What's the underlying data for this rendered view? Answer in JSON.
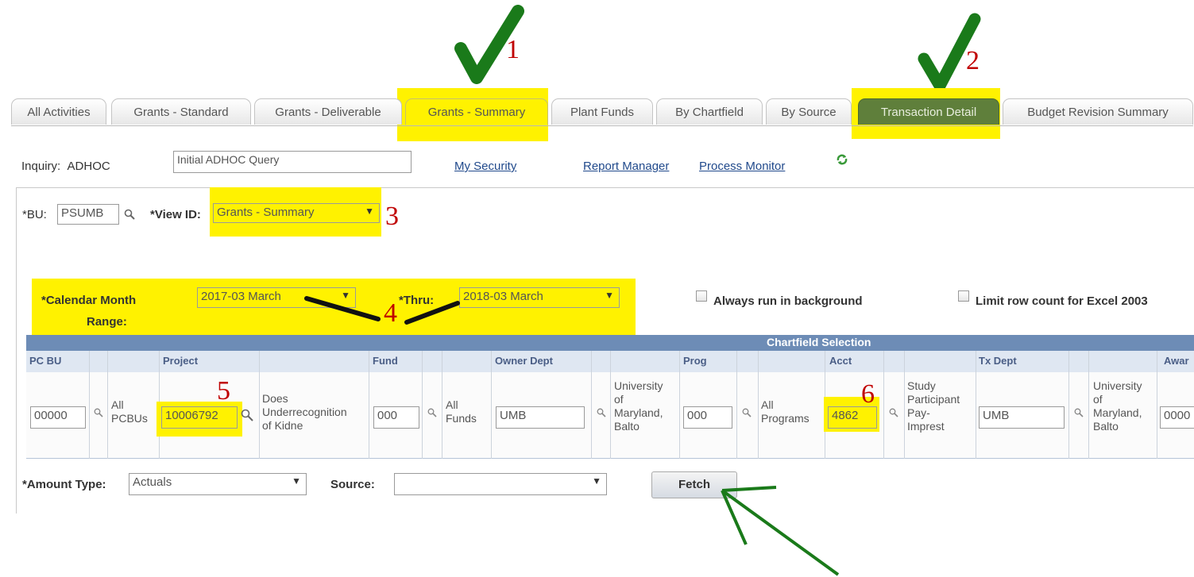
{
  "annotations": {
    "n1": "1",
    "n2": "2",
    "n3": "3",
    "n4": "4",
    "n5": "5",
    "n6": "6"
  },
  "tabs": [
    {
      "label": "All Activities"
    },
    {
      "label": "Grants - Standard"
    },
    {
      "label": "Grants - Deliverable"
    },
    {
      "label": "Grants - Summary"
    },
    {
      "label": "Plant Funds"
    },
    {
      "label": "By Chartfield"
    },
    {
      "label": "By Source"
    },
    {
      "label": "Transaction Detail"
    },
    {
      "label": "Budget Revision Summary"
    }
  ],
  "inquiry": {
    "label": "Inquiry:",
    "value": "ADHOC",
    "description": "Initial ADHOC Query"
  },
  "links": {
    "my_security": "My Security",
    "report_manager": "Report Manager",
    "process_monitor": "Process Monitor"
  },
  "form": {
    "bu_label": "*BU:",
    "bu_value": "PSUMB",
    "view_id_label": "*View ID:",
    "view_id_value": "Grants - Summary",
    "calendar_label_1": "*Calendar Month",
    "calendar_label_2": "Range:",
    "from_value": "2017-03 March",
    "thru_label": "*Thru:",
    "thru_value": "2018-03 March",
    "always_bg_label": "Always run in background",
    "limit_rows_label": "Limit row count for Excel 2003",
    "amount_type_label": "*Amount Type:",
    "amount_type_value": "Actuals",
    "source_label": "Source:",
    "source_value": "",
    "fetch_label": "Fetch"
  },
  "grid": {
    "title": "Chartfield Selection",
    "headers": [
      "PC BU",
      "Project",
      "Fund",
      "Owner Dept",
      "Prog",
      "Acct",
      "Tx Dept",
      "Awar"
    ],
    "pcbu": {
      "value": "00000",
      "desc1": "All",
      "desc2": "PCBUs"
    },
    "project": {
      "value": "10006792",
      "desc1": "Does",
      "desc2": "Underrecognition",
      "desc3": "of Kidne"
    },
    "fund": {
      "value": "000",
      "desc1": "All",
      "desc2": "Funds"
    },
    "owner_dept": {
      "value": "UMB",
      "desc1": "University",
      "desc2": "of",
      "desc3": "Maryland,",
      "desc4": "Balto"
    },
    "prog": {
      "value": "000",
      "desc1": "All",
      "desc2": "Programs"
    },
    "acct": {
      "value": "4862",
      "desc1": "Study",
      "desc2": "Participant",
      "desc3": "Pay-",
      "desc4": "Imprest"
    },
    "tx_dept": {
      "value": "UMB",
      "desc1": "University",
      "desc2": "of",
      "desc3": "Maryland,",
      "desc4": "Balto"
    },
    "award": {
      "value": "0000"
    }
  },
  "colors": {
    "highlight": "#fff200",
    "check": "#1a7a1a",
    "annotation": "#c00000",
    "active_tab": "#5f7f3b",
    "grid_band": "#6d8cb6"
  }
}
